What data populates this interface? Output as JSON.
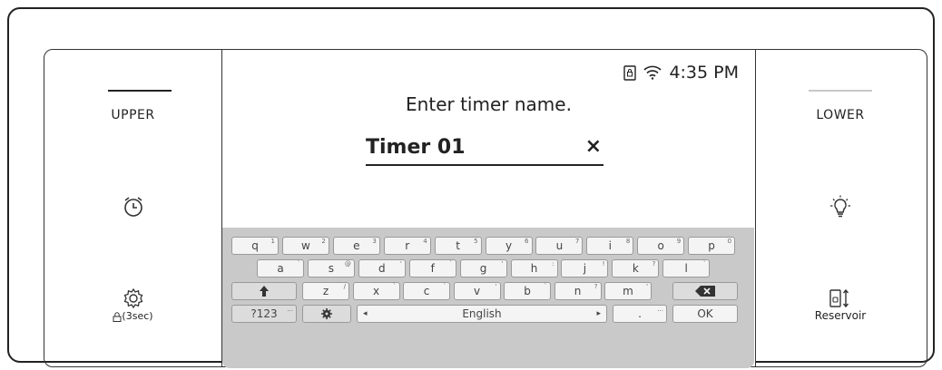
{
  "left_panel": {
    "zone_label": "UPPER",
    "timer_icon": "alarm-clock-icon",
    "settings_icon": "gear-icon",
    "settings_label": "(3sec)"
  },
  "right_panel": {
    "zone_label": "LOWER",
    "light_icon": "light-bulb-icon",
    "reservoir_icon": "reservoir-icon",
    "reservoir_label": "Reservoir"
  },
  "screen": {
    "status": {
      "time": "4:35 PM",
      "icons": [
        "lock-icon",
        "wifi-icon"
      ]
    },
    "prompt": "Enter timer name.",
    "name_field": {
      "value": "Timer 01",
      "clear_label": "×"
    }
  },
  "keyboard": {
    "row1": [
      {
        "k": "q",
        "s": "1"
      },
      {
        "k": "w",
        "s": "2"
      },
      {
        "k": "e",
        "s": "3"
      },
      {
        "k": "r",
        "s": "4"
      },
      {
        "k": "t",
        "s": "5"
      },
      {
        "k": "y",
        "s": "6"
      },
      {
        "k": "u",
        "s": "7"
      },
      {
        "k": "i",
        "s": "8"
      },
      {
        "k": "o",
        "s": "9"
      },
      {
        "k": "p",
        "s": "0"
      }
    ],
    "row2": [
      {
        "k": "a",
        "s": "`"
      },
      {
        "k": "s",
        "s": "@"
      },
      {
        "k": "d",
        "s": "'"
      },
      {
        "k": "f",
        "s": "`"
      },
      {
        "k": "g",
        "s": "'"
      },
      {
        "k": "h",
        "s": ":"
      },
      {
        "k": "j",
        "s": "!"
      },
      {
        "k": "k",
        "s": "?"
      },
      {
        "k": "l",
        "s": "`"
      }
    ],
    "row3": [
      {
        "k": "z",
        "s": "/"
      },
      {
        "k": "x",
        "s": "`"
      },
      {
        "k": "c",
        "s": "`"
      },
      {
        "k": "v",
        "s": "'"
      },
      {
        "k": "b",
        "s": "`"
      },
      {
        "k": "n",
        "s": "?"
      },
      {
        "k": "m",
        "s": "'"
      }
    ],
    "shift_icon": "shift-arrow-icon",
    "backspace_icon": "backspace-icon",
    "numbers_label": "?123",
    "numbers_sup": "...",
    "settings_icon": "gear-icon",
    "space_label": "English",
    "space_left": "◂",
    "space_right": "▸",
    "period_label": ".",
    "period_sup": "...",
    "ok_label": "OK"
  }
}
